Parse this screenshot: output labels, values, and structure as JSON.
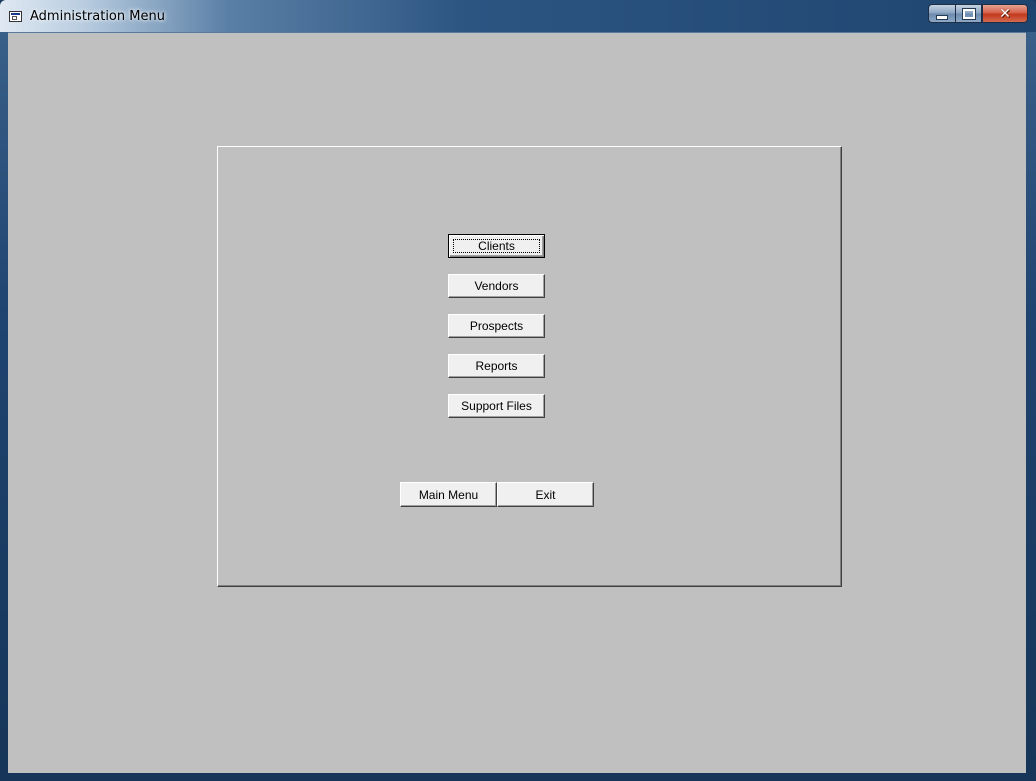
{
  "window": {
    "title": "Administration Menu",
    "minimize_icon": "minimize-icon",
    "maximize_icon": "maximize-icon",
    "close_icon": "close-icon",
    "close_glyph": "✕"
  },
  "menu": {
    "items": [
      {
        "label": "Clients"
      },
      {
        "label": "Vendors"
      },
      {
        "label": "Prospects"
      },
      {
        "label": "Reports"
      },
      {
        "label": "Support Files"
      }
    ]
  },
  "navigation": {
    "main_menu_label": "Main Menu",
    "exit_label": "Exit"
  },
  "colors": {
    "client_background": "#c0c0c0",
    "button_face": "#f0f0f0",
    "close_button": "#c2391d"
  }
}
